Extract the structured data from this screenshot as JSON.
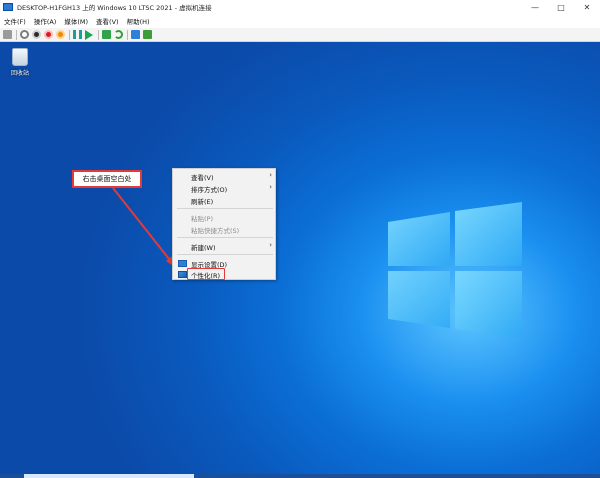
{
  "window": {
    "title": "DESKTOP-H1FGH13 上的 Windows 10 LTSC 2021 - 虚拟机连接",
    "controls": {
      "minimize": "—",
      "maximize": "□",
      "close": "✕"
    }
  },
  "menubar": {
    "items": [
      "文件(F)",
      "操作(A)",
      "媒体(M)",
      "查看(V)",
      "帮助(H)"
    ]
  },
  "toolbar": {
    "icons": [
      "ctrl-alt-del-icon",
      "start-icon",
      "turn-off-icon",
      "shutdown-icon",
      "save-icon",
      "pause-icon",
      "play-icon",
      "checkpoint-icon",
      "revert-icon",
      "enhanced-session-icon",
      "share-icon"
    ]
  },
  "desktop": {
    "recycle_bin_label": "回收站",
    "annotation_text": "右击桌面空白处"
  },
  "context_menu": {
    "items": [
      {
        "label": "查看(V)",
        "submenu": true,
        "disabled": false
      },
      {
        "label": "排序方式(O)",
        "submenu": true,
        "disabled": false
      },
      {
        "label": "刷新(E)",
        "submenu": false,
        "disabled": false
      },
      {
        "label": "粘贴(P)",
        "submenu": false,
        "disabled": true
      },
      {
        "label": "粘贴快捷方式(S)",
        "submenu": false,
        "disabled": true
      },
      {
        "label": "新建(W)",
        "submenu": true,
        "disabled": false
      },
      {
        "label": "显示设置(D)",
        "submenu": false,
        "disabled": false,
        "icon": "display-settings-icon"
      },
      {
        "label": "个性化(R)",
        "submenu": false,
        "disabled": false,
        "icon": "personalize-icon",
        "highlighted": true
      }
    ],
    "submenu_glyph": "›"
  },
  "colors": {
    "annotation_red": "#e23a3a",
    "desktop_blue": "#0b6fd6"
  }
}
